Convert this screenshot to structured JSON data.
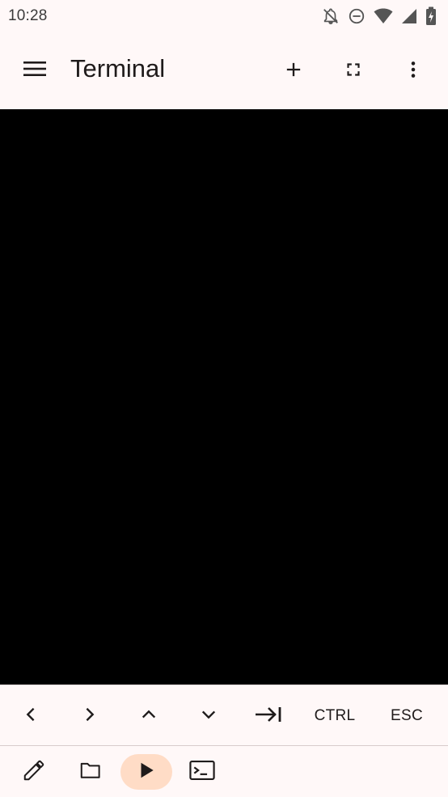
{
  "status_bar": {
    "time": "10:28",
    "icons": [
      "notifications-off-icon",
      "do-not-disturb-icon",
      "wifi-icon",
      "cellular-signal-icon",
      "battery-charging-icon"
    ]
  },
  "app_bar": {
    "title": "Terminal",
    "menu_icon": "hamburger-menu-icon",
    "actions": [
      "add-icon",
      "fullscreen-icon",
      "more-vert-icon"
    ]
  },
  "terminal": {
    "background": "#000000",
    "content": ""
  },
  "extra_keys": {
    "left_icon": "chevron-left-icon",
    "right_icon": "chevron-right-icon",
    "up_icon": "chevron-up-icon",
    "down_icon": "chevron-down-icon",
    "tab_icon": "tab-arrow-icon",
    "ctrl_label": "CTRL",
    "esc_label": "ESC"
  },
  "bottom_bar": {
    "tools": [
      "edit-pencil-icon",
      "folder-icon",
      "run-play-icon",
      "terminal-icon"
    ],
    "active_tool": "run-play-icon",
    "active_color": "#FFDCC6"
  }
}
